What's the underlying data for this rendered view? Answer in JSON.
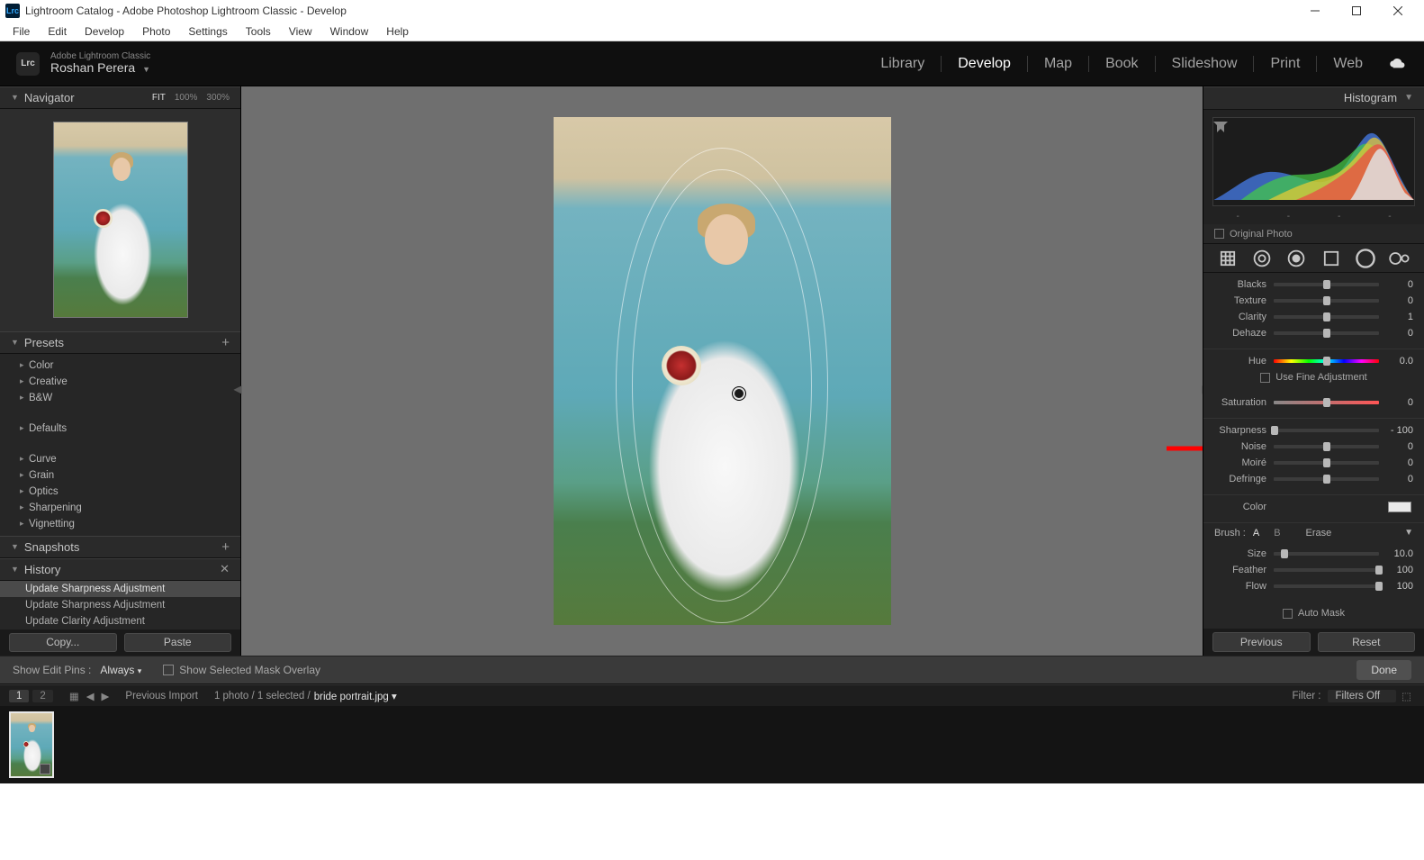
{
  "titlebar": {
    "app_icon_text": "Lrc",
    "title": "Lightroom Catalog - Adobe Photoshop Lightroom Classic - Develop"
  },
  "menubar": [
    "File",
    "Edit",
    "Develop",
    "Photo",
    "Settings",
    "Tools",
    "View",
    "Window",
    "Help"
  ],
  "modhead": {
    "badge": "Lrc",
    "product_line1": "Adobe Lightroom Classic",
    "product_line2": "Roshan Perera",
    "modules": [
      "Library",
      "Develop",
      "Map",
      "Book",
      "Slideshow",
      "Print",
      "Web"
    ],
    "active_module": "Develop"
  },
  "left": {
    "navigator": {
      "title": "Navigator",
      "opts": [
        "FIT",
        "100%",
        "300%"
      ]
    },
    "presets": {
      "title": "Presets",
      "items": [
        "Color",
        "Creative",
        "B&W",
        "",
        "Defaults",
        "",
        "Curve",
        "Grain",
        "Optics",
        "Sharpening",
        "Vignetting"
      ]
    },
    "snapshots": {
      "title": "Snapshots"
    },
    "history": {
      "title": "History",
      "items": [
        "Update Sharpness Adjustment",
        "Update Sharpness Adjustment",
        "Update Clarity Adjustment"
      ],
      "selected": 0
    },
    "copy_btn": "Copy...",
    "paste_btn": "Paste"
  },
  "right": {
    "histogram_title": "Histogram",
    "original_photo": "Original Photo",
    "sliders_top": [
      {
        "label": "Blacks",
        "value": "0",
        "pos": 50
      },
      {
        "label": "Texture",
        "value": "0",
        "pos": 50
      },
      {
        "label": "Clarity",
        "value": "1",
        "pos": 50
      },
      {
        "label": "Dehaze",
        "value": "0",
        "pos": 50
      }
    ],
    "hue": {
      "label": "Hue",
      "value": "0.0",
      "pos": 50
    },
    "fine_adjust": "Use Fine Adjustment",
    "saturation": {
      "label": "Saturation",
      "value": "0",
      "pos": 50
    },
    "sliders_bot": [
      {
        "label": "Sharpness",
        "value": "- 100",
        "pos": 1
      },
      {
        "label": "Noise",
        "value": "0",
        "pos": 50
      },
      {
        "label": "Moiré",
        "value": "0",
        "pos": 50
      },
      {
        "label": "Defringe",
        "value": "0",
        "pos": 50
      }
    ],
    "color_label": "Color",
    "brush": {
      "label": "Brush :",
      "a": "A",
      "b": "B",
      "erase": "Erase"
    },
    "brush_sliders": [
      {
        "label": "Size",
        "value": "10.0",
        "pos": 10
      },
      {
        "label": "Feather",
        "value": "100",
        "pos": 100
      },
      {
        "label": "Flow",
        "value": "100",
        "pos": 100
      }
    ],
    "automask": "Auto Mask",
    "prev_btn": "Previous",
    "reset_btn": "Reset"
  },
  "optbar": {
    "showpins_lbl": "Show Edit Pins :",
    "showpins_val": "Always",
    "overlay": "Show Selected Mask Overlay",
    "done": "Done"
  },
  "fshead": {
    "seg1": "1",
    "seg2": "2",
    "prev_import": "Previous Import",
    "count": "1 photo / 1 selected /",
    "filename": "bride portrait.jpg",
    "filter_lbl": "Filter :",
    "filter_val": "Filters Off"
  }
}
